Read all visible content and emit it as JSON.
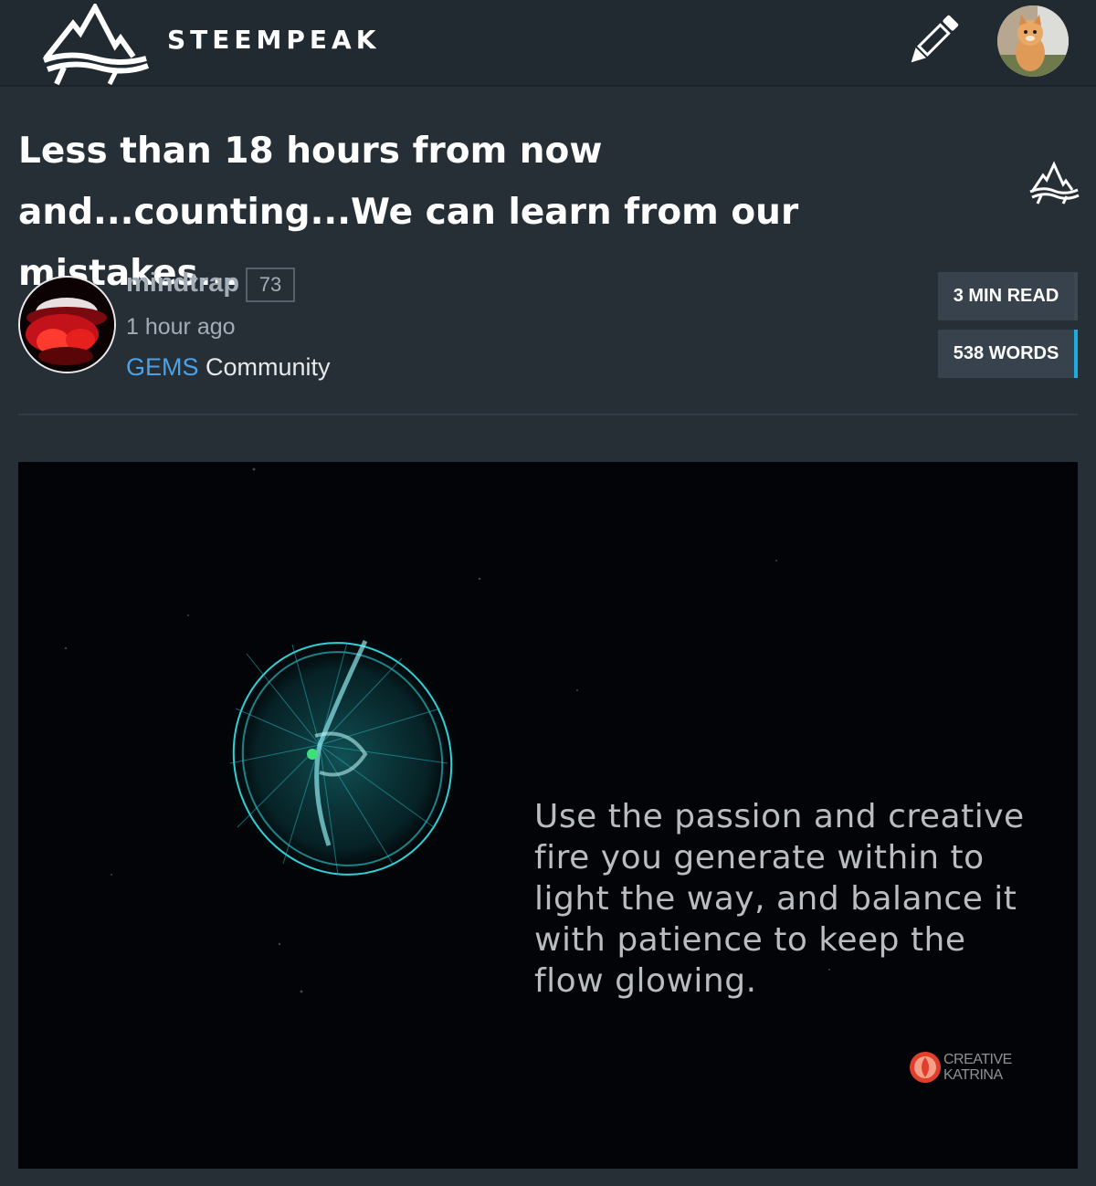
{
  "header": {
    "brand": "STEEMPEAK",
    "logo_icon": "steempeak-mountain-icon",
    "edit_icon": "pencil-icon",
    "user_avatar": "user-avatar-kitten"
  },
  "post": {
    "title": "Less than 18 hours from now and...counting...We can learn from our mistakes...",
    "author": "mindtrap",
    "reputation": "73",
    "time_ago": "1 hour ago",
    "community_name": "GEMS",
    "community_suffix": "Community",
    "read_time": "3 MIN READ",
    "word_count": "538 WORDS"
  },
  "image": {
    "quote": "Use the passion and creative\nfire you generate within to\nlight the way, and balance it\nwith patience to keep the\nflow glowing.",
    "watermark_line1": "CREATIVE",
    "watermark_line2": "KATRINA"
  },
  "colors": {
    "background": "#262e36",
    "topbar": "#222a31",
    "accent": "#4aa3e8",
    "words_border": "#18aee0"
  }
}
